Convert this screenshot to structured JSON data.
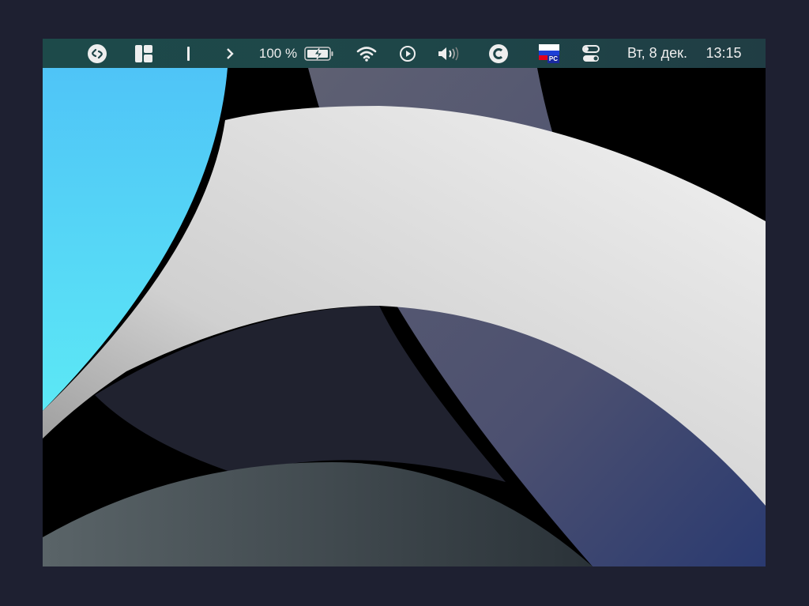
{
  "menubar": {
    "battery_percent": "100 %",
    "flag_label": "PC",
    "date": "Вт, 8 дек.",
    "time": "13:15",
    "icons": [
      "shazam-icon",
      "layout-icon",
      "text-cursor-icon",
      "chevron-right-icon",
      "battery-charging-icon",
      "wifi-icon",
      "play-icon",
      "volume-icon",
      "c-icon",
      "russian-flag-icon",
      "control-center-icon"
    ]
  },
  "colors": {
    "menubar": "#1e4548",
    "cyan": "#4fc8f5",
    "white_band": "#e8e8e8",
    "gray_band": "#5a5c6e"
  }
}
